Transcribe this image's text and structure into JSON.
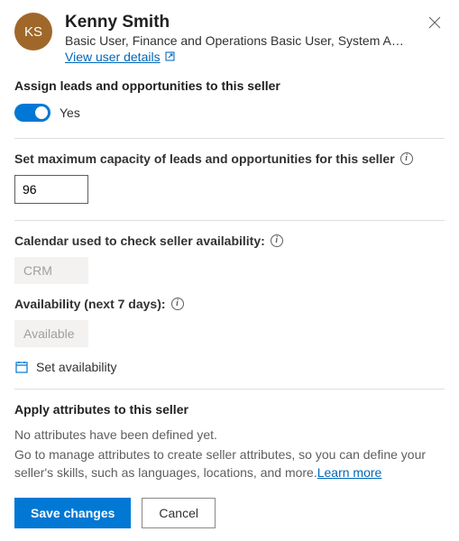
{
  "user": {
    "initials": "KS",
    "name": "Kenny Smith",
    "roles": "Basic User, Finance and Operations Basic User, System Administr…",
    "view_details_label": "View user details"
  },
  "assign": {
    "heading": "Assign leads and opportunities to this seller",
    "toggle_value": "Yes"
  },
  "capacity": {
    "heading": "Set maximum capacity of leads and opportunities for this seller",
    "value": "96"
  },
  "calendar": {
    "heading": "Calendar used to check seller availability:",
    "value": "CRM"
  },
  "availability": {
    "heading": "Availability (next 7 days):",
    "value": "Available",
    "set_label": "Set availability"
  },
  "attributes": {
    "heading": "Apply attributes to this seller",
    "empty_msg": "No attributes have been defined yet.",
    "desc_prefix": "Go to manage attributes to create seller attributes, so you can define your seller's skills, such as languages, locations, and more.",
    "learn_more": "Learn more"
  },
  "footer": {
    "save": "Save changes",
    "cancel": "Cancel"
  }
}
